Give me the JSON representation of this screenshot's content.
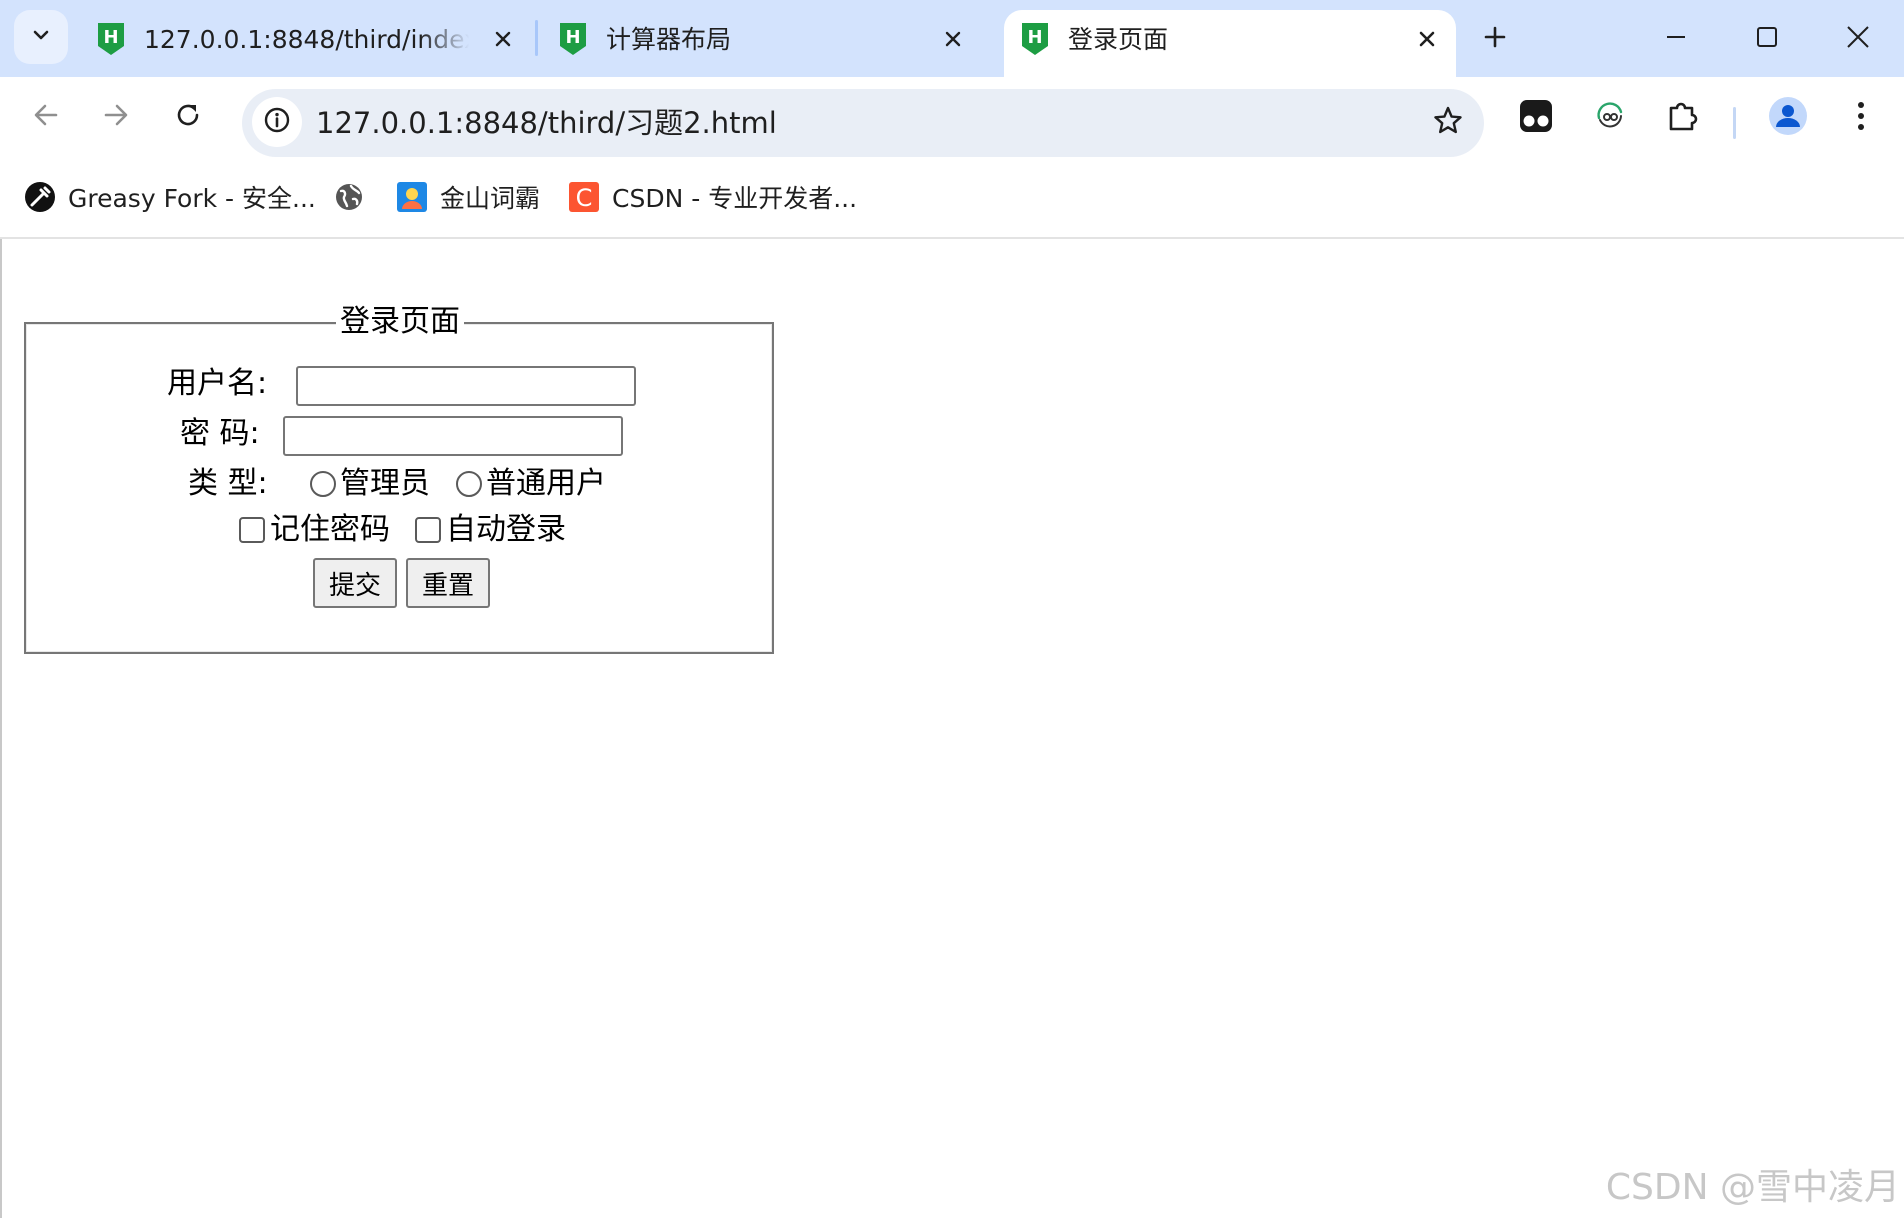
{
  "browser": {
    "tabs": [
      {
        "title": "127.0.0.1:8848/third/index.h",
        "favicon": "hbuilder-icon",
        "active": false
      },
      {
        "title": "计算器布局",
        "favicon": "hbuilder-icon",
        "active": false
      },
      {
        "title": "登录页面",
        "favicon": "hbuilder-icon",
        "active": true
      }
    ],
    "url": "127.0.0.1:8848/third/习题2.html",
    "bookmarks": [
      {
        "label": "Greasy Fork - 安全...",
        "icon": "greasyfork-icon"
      },
      {
        "label": "",
        "icon": "globe-icon"
      },
      {
        "label": "金山词霸",
        "icon": "iciba-icon"
      },
      {
        "label": "CSDN - 专业开发者...",
        "icon": "csdn-icon"
      }
    ],
    "colors": {
      "tabstrip": "#d3e3fd",
      "omnibox": "#e9eef6",
      "accent": "#0b57d0"
    }
  },
  "page": {
    "form": {
      "legend": "登录页面",
      "username_label": "用户名:",
      "password_label": "密 码:",
      "type_label": "类 型:",
      "radio_admin": "管理员",
      "radio_user": "普通用户",
      "check_remember": "记住密码",
      "check_auto": "自动登录",
      "submit_label": "提交",
      "reset_label": "重置"
    },
    "watermark": "CSDN @雪中凌月"
  }
}
